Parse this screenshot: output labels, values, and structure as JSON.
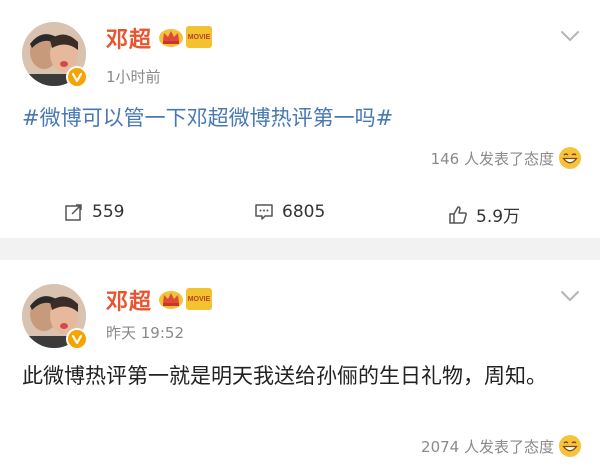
{
  "posts": [
    {
      "username": "邓超",
      "badge_text": "MOVIE",
      "timestamp": "1小时前",
      "text": "#微博可以管一下邓超微博热评第一吗#",
      "reaction_text": "146 人发表了态度",
      "actions": {
        "repost_count": "559",
        "comment_count": "6805",
        "like_count": "5.9万"
      }
    },
    {
      "username": "邓超",
      "badge_text": "MOVIE",
      "timestamp": "昨天 19:52",
      "text": "此微博热评第一就是明天我送给孙俪的生日礼物，周知。",
      "reaction_text": "2074 人发表了态度"
    }
  ],
  "colors": {
    "username": "#e8542e",
    "topic_link": "#4878b5",
    "muted": "#8a8a8a",
    "verified_badge": "#f7a300",
    "separator": "#f2f2f2"
  },
  "icons": [
    "avatar",
    "verified-badge-icon",
    "crown-icon",
    "movie-badge-icon",
    "chevron-down-icon",
    "laughing-emoji-icon",
    "repost-icon",
    "comment-icon",
    "like-icon"
  ]
}
